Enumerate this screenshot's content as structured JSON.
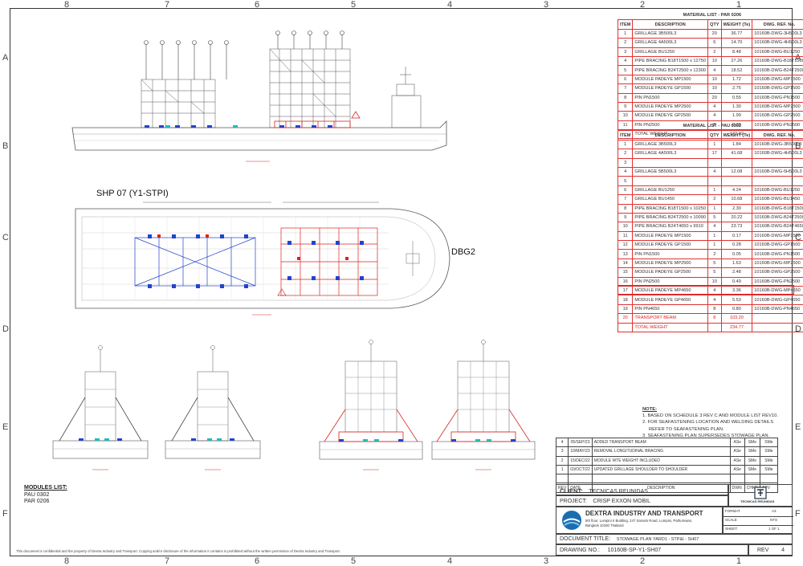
{
  "border": {
    "columns_top": [
      "8",
      "7",
      "6",
      "5",
      "4",
      "3",
      "2",
      "1"
    ],
    "rows_left": [
      "A",
      "B",
      "C",
      "D",
      "E",
      "F"
    ],
    "rows_right": [
      "A",
      "B",
      "C",
      "D",
      "E",
      "F"
    ]
  },
  "table_par": {
    "title": "MATERIAL LIST - PAR 0206",
    "headers": [
      "ITEM",
      "DESCRIPTION",
      "QTY",
      "WEIGHT (Te)",
      "DWG. REF. No."
    ],
    "rows": [
      [
        "1",
        "GRILLAGE 3B500L3",
        "20",
        "36.77",
        "10160B-DWG-3H500L3"
      ],
      [
        "2",
        "GRILLAGE 4A500L3",
        "6",
        "14.70",
        "10160B-DWG-4H500L3"
      ],
      [
        "3",
        "GRILLAGE BU1250",
        "2",
        "8.48",
        "10160B-DWG-BU1250"
      ],
      [
        "4",
        "PIPE BRACING B18T1500 x 12750",
        "10",
        "27.26",
        "10160B-DWG-B18T1500"
      ],
      [
        "5",
        "PIPE BRACING B24T2500 x 12300",
        "4",
        "18.52",
        "10160B-DWG-B24T2500"
      ],
      [
        "6",
        "MODULE PADEYE MP1500",
        "10",
        "1.72",
        "10160B-DWG-MP1500"
      ],
      [
        "7",
        "MODULE PADEYE GP1500",
        "10",
        "2.75",
        "10160B-DWG-GP1500"
      ],
      [
        "8",
        "PIN PN1500",
        "20",
        "0.55",
        "10160B-DWG-PN1500"
      ],
      [
        "9",
        "MODULE PADEYE MP2500",
        "4",
        "1.30",
        "10160B-DWG-MP2500"
      ],
      [
        "10",
        "MODULE PADEYE GP2500",
        "4",
        "1.99",
        "10160B-DWG-GP2500"
      ],
      [
        "11",
        "PIN PN2500",
        "8",
        "0.39",
        "10160B-DWG-PN2500"
      ]
    ],
    "total_label": "TOTAL WEIGHT",
    "total_value": "122.02"
  },
  "table_pau": {
    "title": "MATERIAL LIST - PAU 0302",
    "headers": [
      "ITEM",
      "DESCRIPTION",
      "QTY",
      "WEIGHT (Te)",
      "DWG. REF. No."
    ],
    "rows": [
      [
        "1",
        "GRILLAGE 3B500L3",
        "1",
        "1.84",
        "10160B-DWG-3B500L3"
      ],
      [
        "2",
        "GRILLAGE 4A500L3",
        "17",
        "41.68",
        "10160B-DWG-4H500L3"
      ],
      [
        "3",
        "",
        "",
        "",
        ""
      ],
      [
        "4",
        "GRILLAGE 5B500L3",
        "4",
        "12.08",
        "10160B-DWG-5H500L3"
      ],
      [
        "5",
        "",
        "",
        "",
        ""
      ],
      [
        "6",
        "GRILLAGE BU1250",
        "1",
        "4.24",
        "10160B-DWG-BU1250"
      ],
      [
        "7",
        "GRILLAGE BU1450",
        "2",
        "10.68",
        "10160B-DWG-BU1450"
      ],
      [
        "8",
        "PIPE BRACING B18T1500 x 10250",
        "1",
        "2.30",
        "10160B-DWG-B18T1500"
      ],
      [
        "9",
        "PIPE BRACING B24T2500 x 10090",
        "5",
        "20.22",
        "10160B-DWG-B24T2500"
      ],
      [
        "10",
        "PIPE BRACING B24T4650 x 9910",
        "4",
        "23.73",
        "10160B-DWG-B24T4650"
      ],
      [
        "11",
        "MODULE PADEYE MP1500",
        "1",
        "0.17",
        "10160B-DWG-MP1500"
      ],
      [
        "12",
        "MODULE PADEYE GP1500",
        "1",
        "0.28",
        "10160B-DWG-GP1500"
      ],
      [
        "13",
        "PIN PN1500",
        "2",
        "0.05",
        "10160B-DWG-PN1500"
      ],
      [
        "14",
        "MODULE PADEYE MP2500",
        "5",
        "1.63",
        "10160B-DWG-MP2500"
      ],
      [
        "15",
        "MODULE PADEYE GP2500",
        "5",
        "2.48",
        "10160B-DWG-GP2500"
      ],
      [
        "16",
        "PIN PN2500",
        "10",
        "0.49",
        "10160B-DWG-PN2500"
      ],
      [
        "17",
        "MODULE PADEYE MP4650",
        "4",
        "3.36",
        "10160B-DWG-MP4650"
      ],
      [
        "18",
        "MODULE PADEYE GP4650",
        "4",
        "5.53",
        "10160B-DWG-GP4650"
      ],
      [
        "19",
        "PIN PN4650",
        "8",
        "0.80",
        "10160B-DWG-PN4650"
      ],
      [
        "20",
        "TRANSPORT BEAM",
        "8",
        "103.20",
        ""
      ]
    ],
    "total_label": "TOTAL WEIGHT",
    "total_value": "234.77"
  },
  "notes": {
    "heading": "NOTE:",
    "lines": [
      "1. BASED ON SCHEDULE 3 REV C AND MODULE LIST REV10.",
      "2. FOR SEAFASTENING LOCATION AND WELDING DETAILS",
      "    REFER TO SEAFASTENING PLAN.",
      "3. SEAFASTENING PLAN SUPERSEDES STOWAGE PLAN."
    ]
  },
  "revisions": {
    "rows": [
      [
        "4",
        "05/SEP/23",
        "ADDED TRANSPORT BEAM",
        "ASe",
        "SMe",
        "SMe"
      ],
      [
        "3",
        "10/MAY/23",
        "REMOVAL LONGITUDINAL BRACING",
        "ASe",
        "SMe",
        "SMe"
      ],
      [
        "2",
        "15/DEC/22",
        "MODULE WTE WEIGHT INCLUDED",
        "ASe",
        "SMe",
        "SMe"
      ],
      [
        "1",
        "03/OCT/22",
        "UPDATED GRILLAGE SHOULDER TO SHOULDER",
        "ASe",
        "SMe",
        "SMe"
      ]
    ],
    "header": [
      "REV",
      "DATE",
      "DESCRIPTION",
      "DWN",
      "CHKD",
      "APV"
    ]
  },
  "title_block": {
    "client_label": "CLIENT:",
    "client_value": "TECNICAS REUNIDAS",
    "project_label": "PROJECT:",
    "project_value": "CRISP EXXON MOBIL",
    "company_name": "DEXTRA INDUSTRY AND TRANSPORT",
    "company_address_1": "5th floor, Lumpini II Building, 247 Sarasin Road, Lumpini, Pathumwan,",
    "company_address_2": "Bangkok 10330 Thailand",
    "format_label": "FORMAT",
    "format_value": "A3",
    "scale_label": "SCALE",
    "scale_value": "NTS",
    "sheet_label": "SHEET:",
    "sheet_value": "1 OF 1",
    "doc_title_label": "DOCUMENT TITLE:",
    "doc_title_value": "STOWAGE PLAN YARD1 - STP&I - SH07",
    "drawing_no_label": "DRAWING NO.:",
    "drawing_no_value": "10160B-SP-Y1-SH07",
    "rev_label": "REV",
    "rev_value": "4",
    "logo_text": "TECNICAS REUNIDAS"
  },
  "drawing_labels": {
    "ship_name": "SHP 07 (Y1-STPI)",
    "barge_name": "DBG2",
    "triangle_rev": "4"
  },
  "modules_list": {
    "heading": "MODULES LIST:",
    "items": [
      "PAU 0302",
      "PAR 0206"
    ]
  },
  "disclaimer": "This document is confidential and the property of Dextra Industry and Transport. Copying and/or disclosure of the information it contains is prohibited without the written permission of Dextra Industry and Transport."
}
